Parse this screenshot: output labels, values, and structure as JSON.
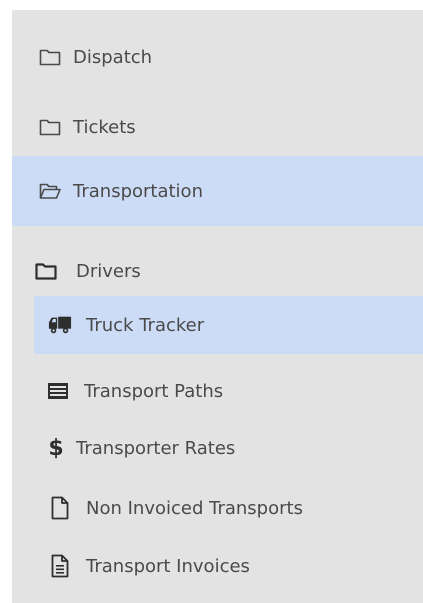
{
  "sidebar": {
    "items": [
      {
        "label": "Dispatch",
        "icon": "folder-icon"
      },
      {
        "label": "Tickets",
        "icon": "folder-icon"
      },
      {
        "label": "Transportation",
        "icon": "folder-open-icon",
        "active": true
      }
    ],
    "sub_items": [
      {
        "label": "Drivers",
        "icon": "folder-icon"
      },
      {
        "label": "Truck Tracker",
        "icon": "truck-icon",
        "active": true
      },
      {
        "label": "Transport Paths",
        "icon": "list-icon"
      },
      {
        "label": "Transporter Rates",
        "icon": "dollar-icon"
      },
      {
        "label": "Non Invoiced Transports",
        "icon": "file-icon"
      },
      {
        "label": "Transport Invoices",
        "icon": "file-text-icon"
      }
    ]
  },
  "colors": {
    "sidebar_bg": "#e3e3e3",
    "active_bg": "#cddcf6",
    "text": "#4a4a4a"
  }
}
